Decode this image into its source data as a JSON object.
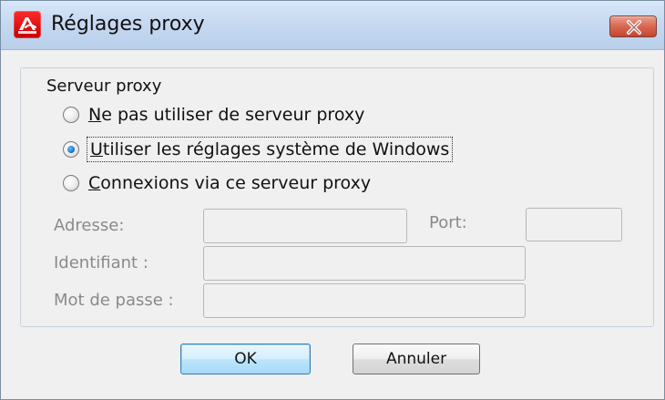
{
  "window": {
    "title": "Réglages proxy"
  },
  "colors": {
    "titlebar": "#c6d9f1",
    "close_button": "#c5452d",
    "default_button": "#bde6fd",
    "window_background": "#f0f0f0"
  },
  "icons": {
    "app": "avira-umbrella-icon",
    "close": "close-icon"
  },
  "group": {
    "title": "Serveur proxy",
    "options": [
      {
        "mnemonic": "N",
        "rest": "e pas utiliser de serveur proxy",
        "checked": false
      },
      {
        "mnemonic": "U",
        "rest": "tiliser les réglages système de Windows",
        "checked": true
      },
      {
        "mnemonic": "C",
        "rest": "onnexions via ce serveur proxy",
        "checked": false
      }
    ],
    "fields": {
      "address_label": "Adresse:",
      "port_label": "Port:",
      "identifier_label": "Identifiant :",
      "password_label": "Mot de passe :",
      "address_value": "",
      "port_value": "",
      "identifier_value": "",
      "password_value": ""
    }
  },
  "buttons": {
    "ok": "OK",
    "cancel": "Annuler"
  }
}
